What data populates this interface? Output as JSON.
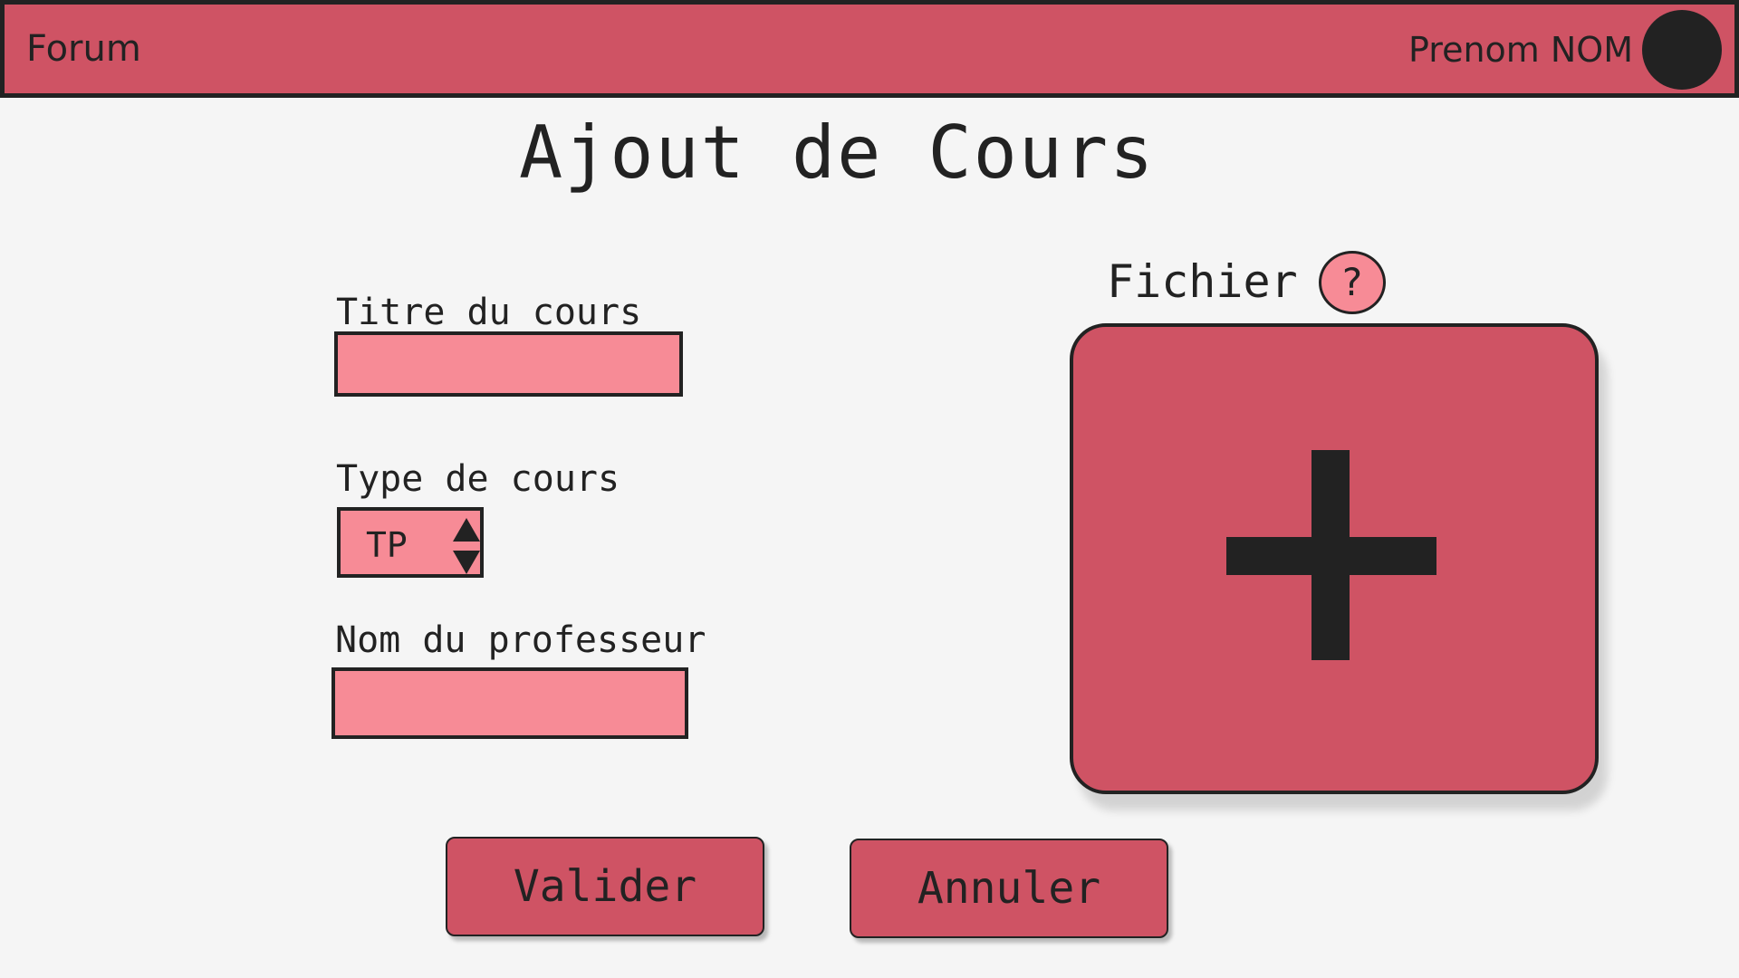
{
  "header": {
    "app_name": "Forum",
    "user_name": "Prenom NOM"
  },
  "page": {
    "title": "Ajout de Cours"
  },
  "form": {
    "title_label": "Titre du cours",
    "title_value": "",
    "type_label": "Type de cours",
    "type_value": "TP",
    "professor_label": "Nom du professeur",
    "professor_value": ""
  },
  "file": {
    "label": "Fichier",
    "help_symbol": "?",
    "dropzone_icon": "plus-icon"
  },
  "actions": {
    "submit_label": "Valider",
    "cancel_label": "Annuler"
  },
  "colors": {
    "primary": "#cf5364",
    "field": "#f78b96",
    "text": "#222222",
    "background": "#f5f5f5"
  }
}
